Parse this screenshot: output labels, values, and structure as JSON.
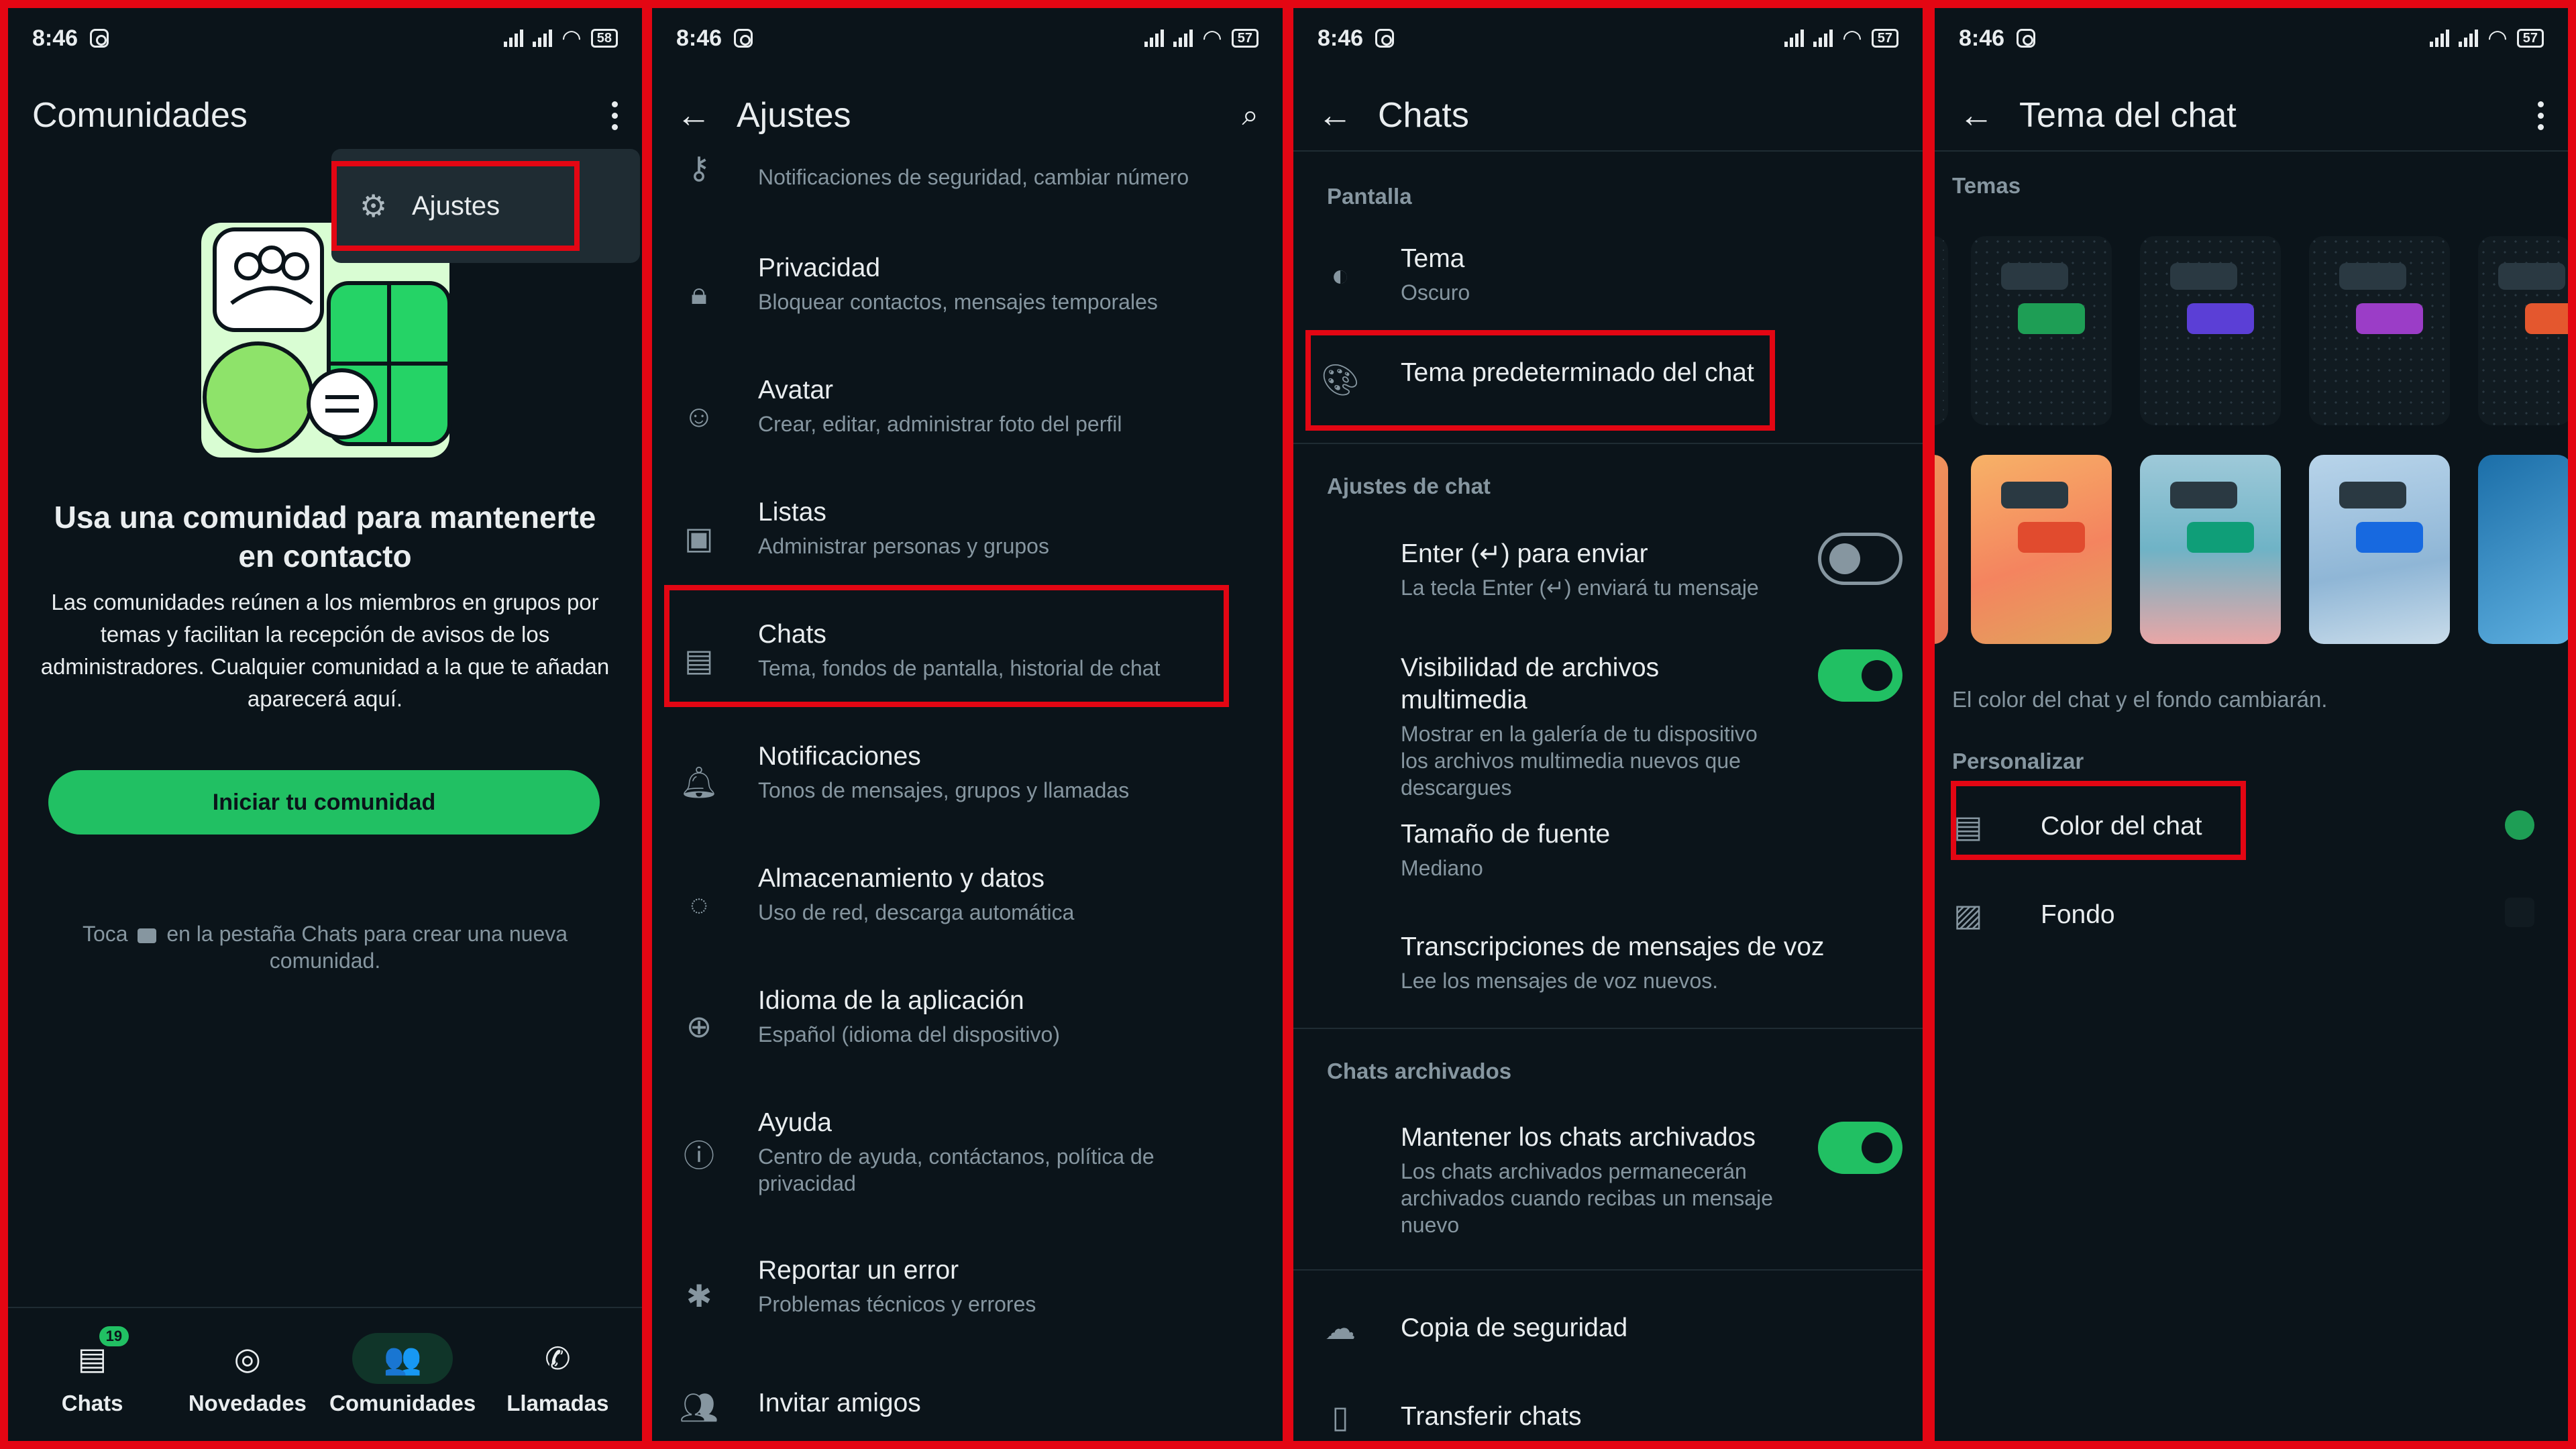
{
  "status": {
    "time": "8:46"
  },
  "panel1": {
    "title": "Comunidades",
    "menu_item": "Ajustes",
    "heading_line1": "Usa una comunidad para mantenerte",
    "heading_line2": "en contacto",
    "body": "Las comunidades reúnen a los miembros en grupos por temas y facilitan la recepción de avisos de los administradores. Cualquier comunidad a la que te añadan aparecerá aquí.",
    "button": "Iniciar tu comunidad",
    "hint_pre": "Toca",
    "hint_post": "en la pestaña Chats para crear una nueva comunidad.",
    "battery": "58",
    "nav": [
      {
        "label": "Chats",
        "icon": "chats-icon",
        "badge": "19"
      },
      {
        "label": "Novedades",
        "icon": "updates-icon"
      },
      {
        "label": "Comunidades",
        "icon": "communities-icon"
      },
      {
        "label": "Llamadas",
        "icon": "phone-icon"
      }
    ]
  },
  "panel2": {
    "title": "Ajustes",
    "battery": "57",
    "items": [
      {
        "title": "",
        "sub": "Notificaciones de seguridad, cambiar número",
        "icon": "key-icon"
      },
      {
        "title": "Privacidad",
        "sub": "Bloquear contactos, mensajes temporales",
        "icon": "lock-icon"
      },
      {
        "title": "Avatar",
        "sub": "Crear, editar, administrar foto del perfil",
        "icon": "avatar-icon"
      },
      {
        "title": "Listas",
        "sub": "Administrar personas y grupos",
        "icon": "lists-icon"
      },
      {
        "title": "Chats",
        "sub": "Tema, fondos de pantalla, historial de chat",
        "icon": "chat-icon"
      },
      {
        "title": "Notificaciones",
        "sub": "Tonos de mensajes, grupos y llamadas",
        "icon": "bell-icon"
      },
      {
        "title": "Almacenamiento y datos",
        "sub": "Uso de red, descarga automática",
        "icon": "storage-icon"
      },
      {
        "title": "Idioma de la aplicación",
        "sub": "Español (idioma del dispositivo)",
        "icon": "globe-icon"
      },
      {
        "title": "Ayuda",
        "sub": "Centro de ayuda, contáctanos, política de privacidad",
        "icon": "help-icon"
      },
      {
        "title": "Reportar un error",
        "sub": "Problemas técnicos y errores",
        "icon": "bug-icon"
      },
      {
        "title": "Invitar amigos",
        "sub": "",
        "icon": "people-icon"
      }
    ]
  },
  "panel3": {
    "title": "Chats",
    "battery": "57",
    "section_display": "Pantalla",
    "theme_title": "Tema",
    "theme_value": "Oscuro",
    "default_theme": "Tema predeterminado del chat",
    "section_chat_settings": "Ajustes de chat",
    "enter_title": "Enter (↵) para enviar",
    "enter_sub": "La tecla Enter (↵) enviará tu mensaje",
    "media_title": "Visibilidad de archivos multimedia",
    "media_sub": "Mostrar en la galería de tu dispositivo los archivos multimedia nuevos que descargues",
    "font_title": "Tamaño de fuente",
    "font_value": "Mediano",
    "voice_title": "Transcripciones de mensajes de voz",
    "voice_sub": "Lee los mensajes de voz nuevos.",
    "section_archived": "Chats archivados",
    "archived_title": "Mantener los chats archivados",
    "archived_sub": "Los chats archivados permanecerán archivados cuando recibas un mensaje nuevo",
    "backup": "Copia de seguridad",
    "transfer": "Transferir chats",
    "toggles": {
      "enter": false,
      "media": true,
      "archived": true
    }
  },
  "panel4": {
    "title": "Tema del chat",
    "battery": "57",
    "section_themes": "Temas",
    "note": "El color del chat y el fondo cambiarán.",
    "section_custom": "Personalizar",
    "color_label": "Color del chat",
    "bg_label": "Fondo",
    "theme_colors_row1": [
      "#1e9e55",
      "#5b3fd6",
      "#9b3dc7",
      "#e4572e"
    ],
    "theme_colors_row2": [
      "#e14b2e",
      "#0f9e78",
      "#1769e0",
      "#1a8fd6"
    ]
  },
  "colors": {
    "accent": "#21c063",
    "highlight": "#e30613",
    "bg": "#0b141a"
  }
}
